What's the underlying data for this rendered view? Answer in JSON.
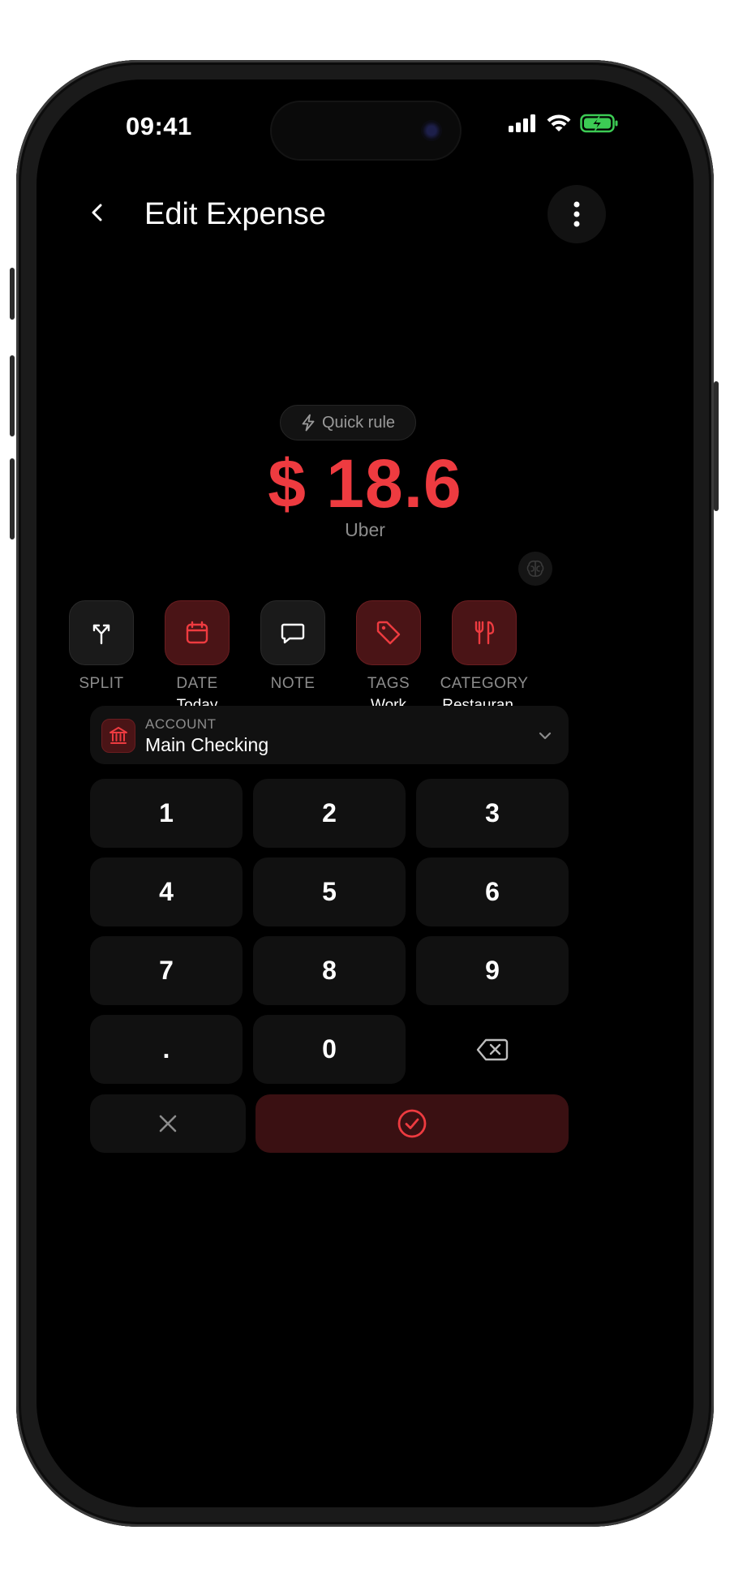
{
  "status_bar": {
    "time": "09:41"
  },
  "header": {
    "title": "Edit Expense"
  },
  "quick_rule": {
    "label": "Quick rule"
  },
  "amount": {
    "display": "$ 18.6",
    "currency": "$",
    "value": 18.6
  },
  "merchant": {
    "name": "Uber"
  },
  "actions": [
    {
      "label": "SPLIT",
      "value": "",
      "icon": "split-icon"
    },
    {
      "label": "DATE",
      "value": "Today",
      "icon": "calendar-icon"
    },
    {
      "label": "NOTE",
      "value": "",
      "icon": "note-icon"
    },
    {
      "label": "TAGS",
      "value": "Work",
      "icon": "tag-icon"
    },
    {
      "label": "CATEGORY",
      "value": "Restauran...",
      "icon": "fork-knife-icon"
    }
  ],
  "account": {
    "label": "ACCOUNT",
    "value": "Main Checking",
    "icon": "bank-icon"
  },
  "keypad": {
    "keys": [
      "1",
      "2",
      "3",
      "4",
      "5",
      "6",
      "7",
      "8",
      "9",
      ".",
      "0"
    ],
    "backspace_icon": "backspace-icon"
  },
  "colors": {
    "accent": "#ee3b40",
    "accent_bg": "#4a1416",
    "surface": "#111111",
    "background": "#000000"
  }
}
